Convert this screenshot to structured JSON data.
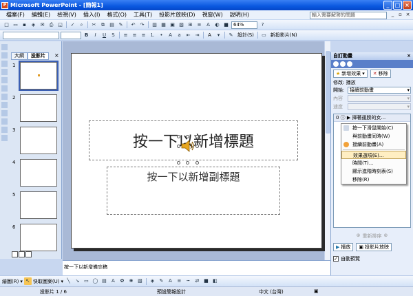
{
  "window": {
    "title": "Microsoft PowerPoint - [簡報1]"
  },
  "menu": [
    "檔案(F)",
    "編輯(E)",
    "檢視(V)",
    "插入(I)",
    "格式(O)",
    "工具(T)",
    "投影片放映(D)",
    "視窗(W)",
    "說明(H)"
  ],
  "help_placeholder": "輸入需要解答的問題",
  "toolbar": {
    "zoom": "64%",
    "design_label": "設計(S)",
    "new_slide_label": "新投影片(N)"
  },
  "pane_tabs": [
    "大綱",
    "投影片"
  ],
  "slides": [
    "1",
    "2",
    "3",
    "4",
    "5",
    "6"
  ],
  "slide": {
    "title_placeholder": "按一下以新增標題",
    "subtitle_placeholder": "按一下以新增副標題"
  },
  "notes_placeholder": "按一下以新增備忘稿",
  "task_pane": {
    "title": "自訂動畫",
    "add_effect": "新增效果",
    "remove": "移除",
    "modify": "修改: 播放",
    "start_label": "開始:",
    "start_value": "接續前動畫",
    "property_label": "內容",
    "speed_label": "速度",
    "anim_item": "0 ⓘ ▶ 揮著翅膀的女...",
    "context_menu": [
      "按一下滑鼠開始(C)",
      "與前動畫同時(W)",
      "接續前動畫(A)",
      "效果選項(E)...",
      "時間(T)...",
      "顯示進階時刻表(S)",
      "移除(R)"
    ],
    "reorder": "重新排序",
    "play": "播放",
    "slideshow": "投影片放映",
    "autopreview": "自動預覽"
  },
  "drawbar": {
    "draw": "繪圖(R)",
    "autoshape": "快取圖案(U)"
  },
  "status": {
    "slide": "投影片 1 / 6",
    "design": "預設簡報設計",
    "lang": "中文 (台灣)"
  }
}
